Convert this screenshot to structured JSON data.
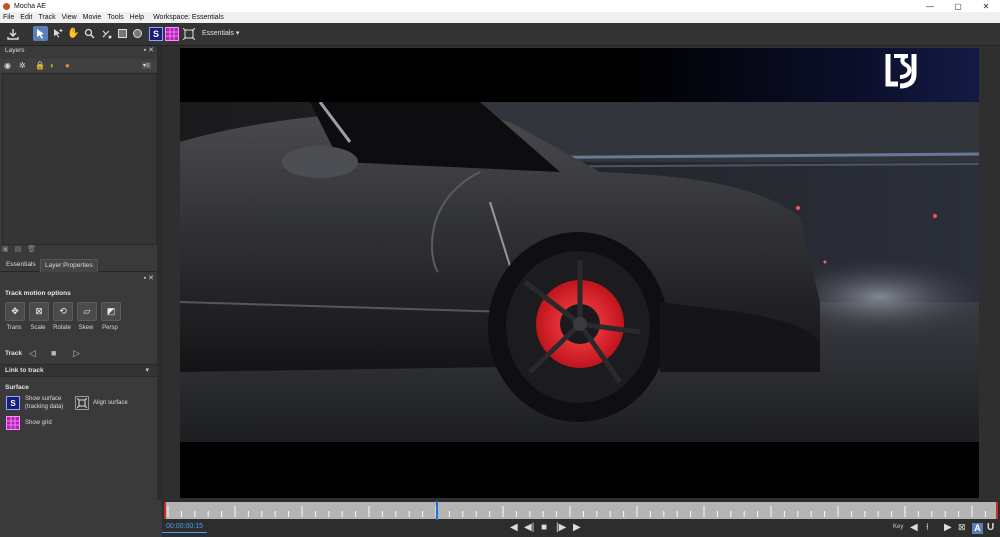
{
  "window": {
    "title": "Mocha AE",
    "minimize": "—",
    "maximize": "▢",
    "close": "✕"
  },
  "menu": [
    "File",
    "Edit",
    "Track",
    "View",
    "Movie",
    "Tools",
    "Help"
  ],
  "workspace_label": "Workspace: Essentials",
  "toolbar": {
    "workspace_dropdown": "Essentials ▾",
    "surface_button": "S"
  },
  "layers_panel": {
    "title": "Layers",
    "header_icons": "▪ ✕",
    "column_icons": [
      "eye-icon",
      "gear-icon",
      "lock-icon",
      "color-icon",
      "matte-icon"
    ],
    "list_menu": "▾≡"
  },
  "tabs": [
    "Essentials",
    "Layer Properties"
  ],
  "track_motion": {
    "title": "Track motion options",
    "options": [
      {
        "name": "trans",
        "label": "Trans",
        "glyph": "✥"
      },
      {
        "name": "scale",
        "label": "Scale",
        "glyph": "⊠"
      },
      {
        "name": "rotate",
        "label": "Rotate",
        "glyph": "⟲"
      },
      {
        "name": "skew",
        "label": "Skew",
        "glyph": "▱"
      },
      {
        "name": "persp",
        "label": "Persp",
        "glyph": "◩"
      }
    ]
  },
  "track": {
    "label": "Track",
    "backward": "◁",
    "stop": "■",
    "forward": "▷"
  },
  "link_to_track": {
    "label": "Link to track",
    "arrow": "▾"
  },
  "surface": {
    "title": "Surface",
    "show_surface_line1": "Show surface",
    "show_surface_line2": "(tracking data)",
    "align_surface": "Align surface",
    "show_grid": "Show grid",
    "icon_s": "S"
  },
  "timeline": {
    "timecode": "00:00:00:15",
    "playhead_fraction": 0.326,
    "key_label": "Key",
    "transport": {
      "prev": "◀",
      "step_back": "◀|",
      "stop": "■",
      "step_fwd": "|▶",
      "next": "▶"
    },
    "key_buttons": {
      "prev_key": "◀",
      "add_key": "⍿",
      "next_key": "▶",
      "all": "⊠",
      "auto": "A",
      "u": "U"
    }
  },
  "colors": {
    "accent": "#5b7db8",
    "timecode": "#4aa0f0",
    "surface": "#1c1d7a",
    "grid": "#b623b4",
    "caliper": "#e0262c"
  }
}
